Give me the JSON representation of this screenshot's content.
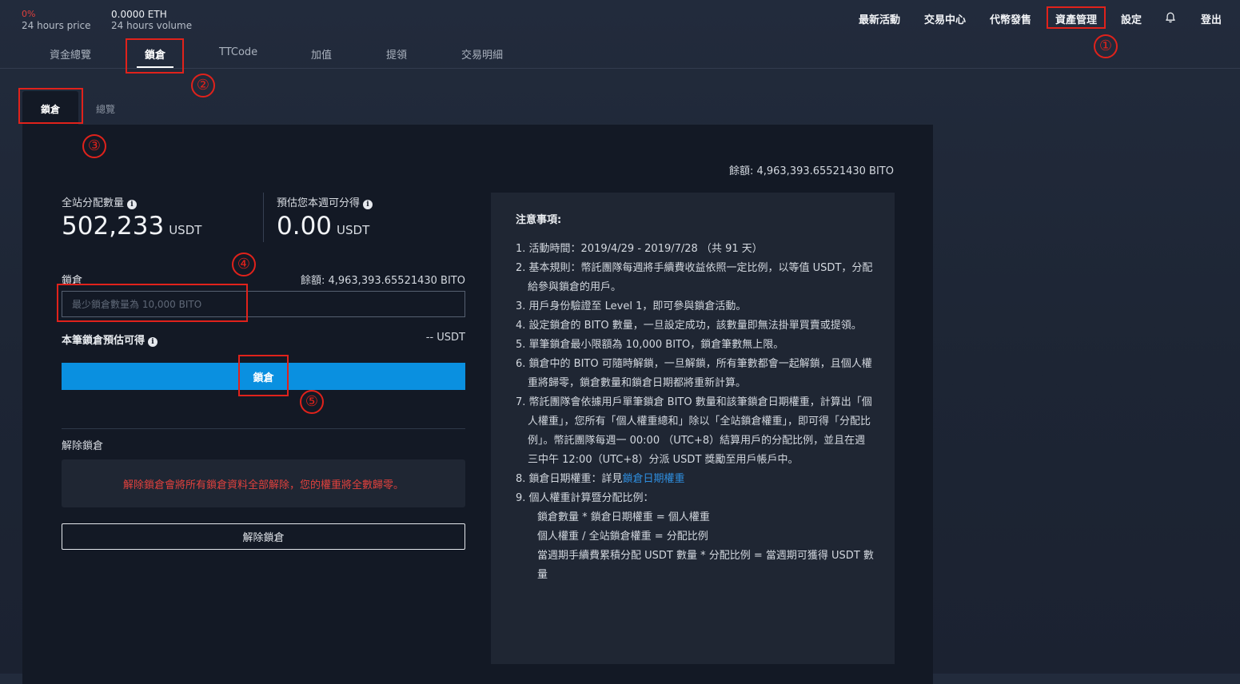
{
  "ticker": {
    "change_pct": "0%",
    "price_label": "24 hours price",
    "volume_value": "0.0000 ETH",
    "volume_label": "24 hours volume"
  },
  "topnav": {
    "items": [
      "最新活動",
      "交易中心",
      "代幣發售",
      "資產管理",
      "設定"
    ],
    "bell_icon": "bell-icon",
    "logout": "登出"
  },
  "subnav": {
    "items": [
      "資金總覽",
      "鎖倉",
      "TTCode",
      "加值",
      "提領",
      "交易明細"
    ],
    "active_index": 1
  },
  "tabs": {
    "items": [
      "鎖倉",
      "總覽"
    ],
    "active_index": 0
  },
  "balance_top": "餘額: 4,963,393.65521430 BITO",
  "stats": {
    "site_label": "全站分配數量",
    "site_value": "502,233",
    "site_unit": "USDT",
    "estimate_label": "預估您本週可分得",
    "estimate_value": "0.00",
    "estimate_unit": "USDT"
  },
  "lock_form": {
    "label": "鎖倉",
    "balance": "餘額: 4,963,393.65521430 BITO",
    "input_value": "",
    "input_placeholder": "最少鎖倉數量為 10,000 BITO",
    "estimate_label": "本筆鎖倉預估可得",
    "estimate_value": "-- USDT",
    "button": "鎖倉"
  },
  "unlock": {
    "label": "解除鎖倉",
    "warning": "解除鎖倉會將所有鎖倉資料全部解除，您的權重將全數歸零。",
    "button": "解除鎖倉"
  },
  "notice": {
    "title": "注意事項:",
    "items": [
      "1. 活動時間：2019/4/29 - 2019/7/28 （共 91 天）",
      "2. 基本規則：幣託團隊每週將手續費收益依照一定比例，以等值 USDT，分配給參與鎖倉的用戶。",
      "3. 用戶身份驗證至 Level 1，即可參與鎖倉活動。",
      "4. 設定鎖倉的 BITO 數量，一旦設定成功，該數量即無法掛單買賣或提領。",
      "5. 單筆鎖倉最小限額為 10,000 BITO，鎖倉筆數無上限。",
      "6. 鎖倉中的 BITO 可隨時解鎖，一旦解鎖，所有筆數都會一起解鎖，且個人權重將歸零，鎖倉數量和鎖倉日期都將重新計算。",
      "7. 幣託團隊會依據用戶單筆鎖倉 BITO 數量和該筆鎖倉日期權重，計算出「個人權重」，您所有「個人權重總和」除以「全站鎖倉權重」，即可得「分配比例」。幣託團隊每週一 00:00 （UTC+8）結算用戶的分配比例，並且在週三中午 12:00（UTC+8）分派 USDT 獎勵至用戶帳戶中。"
    ],
    "item8_prefix": "8. 鎖倉日期權重：詳見",
    "item8_link": "鎖倉日期權重",
    "item9": "9. 個人權重計算暨分配比例：",
    "formulas": [
      "鎖倉數量 * 鎖倉日期權重 = 個人權重",
      "個人權重 / 全站鎖倉權重 = 分配比例",
      "當週期手續費累積分配 USDT 數量 * 分配比例 = 當週期可獲得 USDT 數量"
    ]
  },
  "annotations": [
    "①",
    "②",
    "③",
    "④",
    "⑤"
  ],
  "colors": {
    "accent": "#0a90e0",
    "danger": "#e0413d",
    "annotation": "#e0221b"
  }
}
